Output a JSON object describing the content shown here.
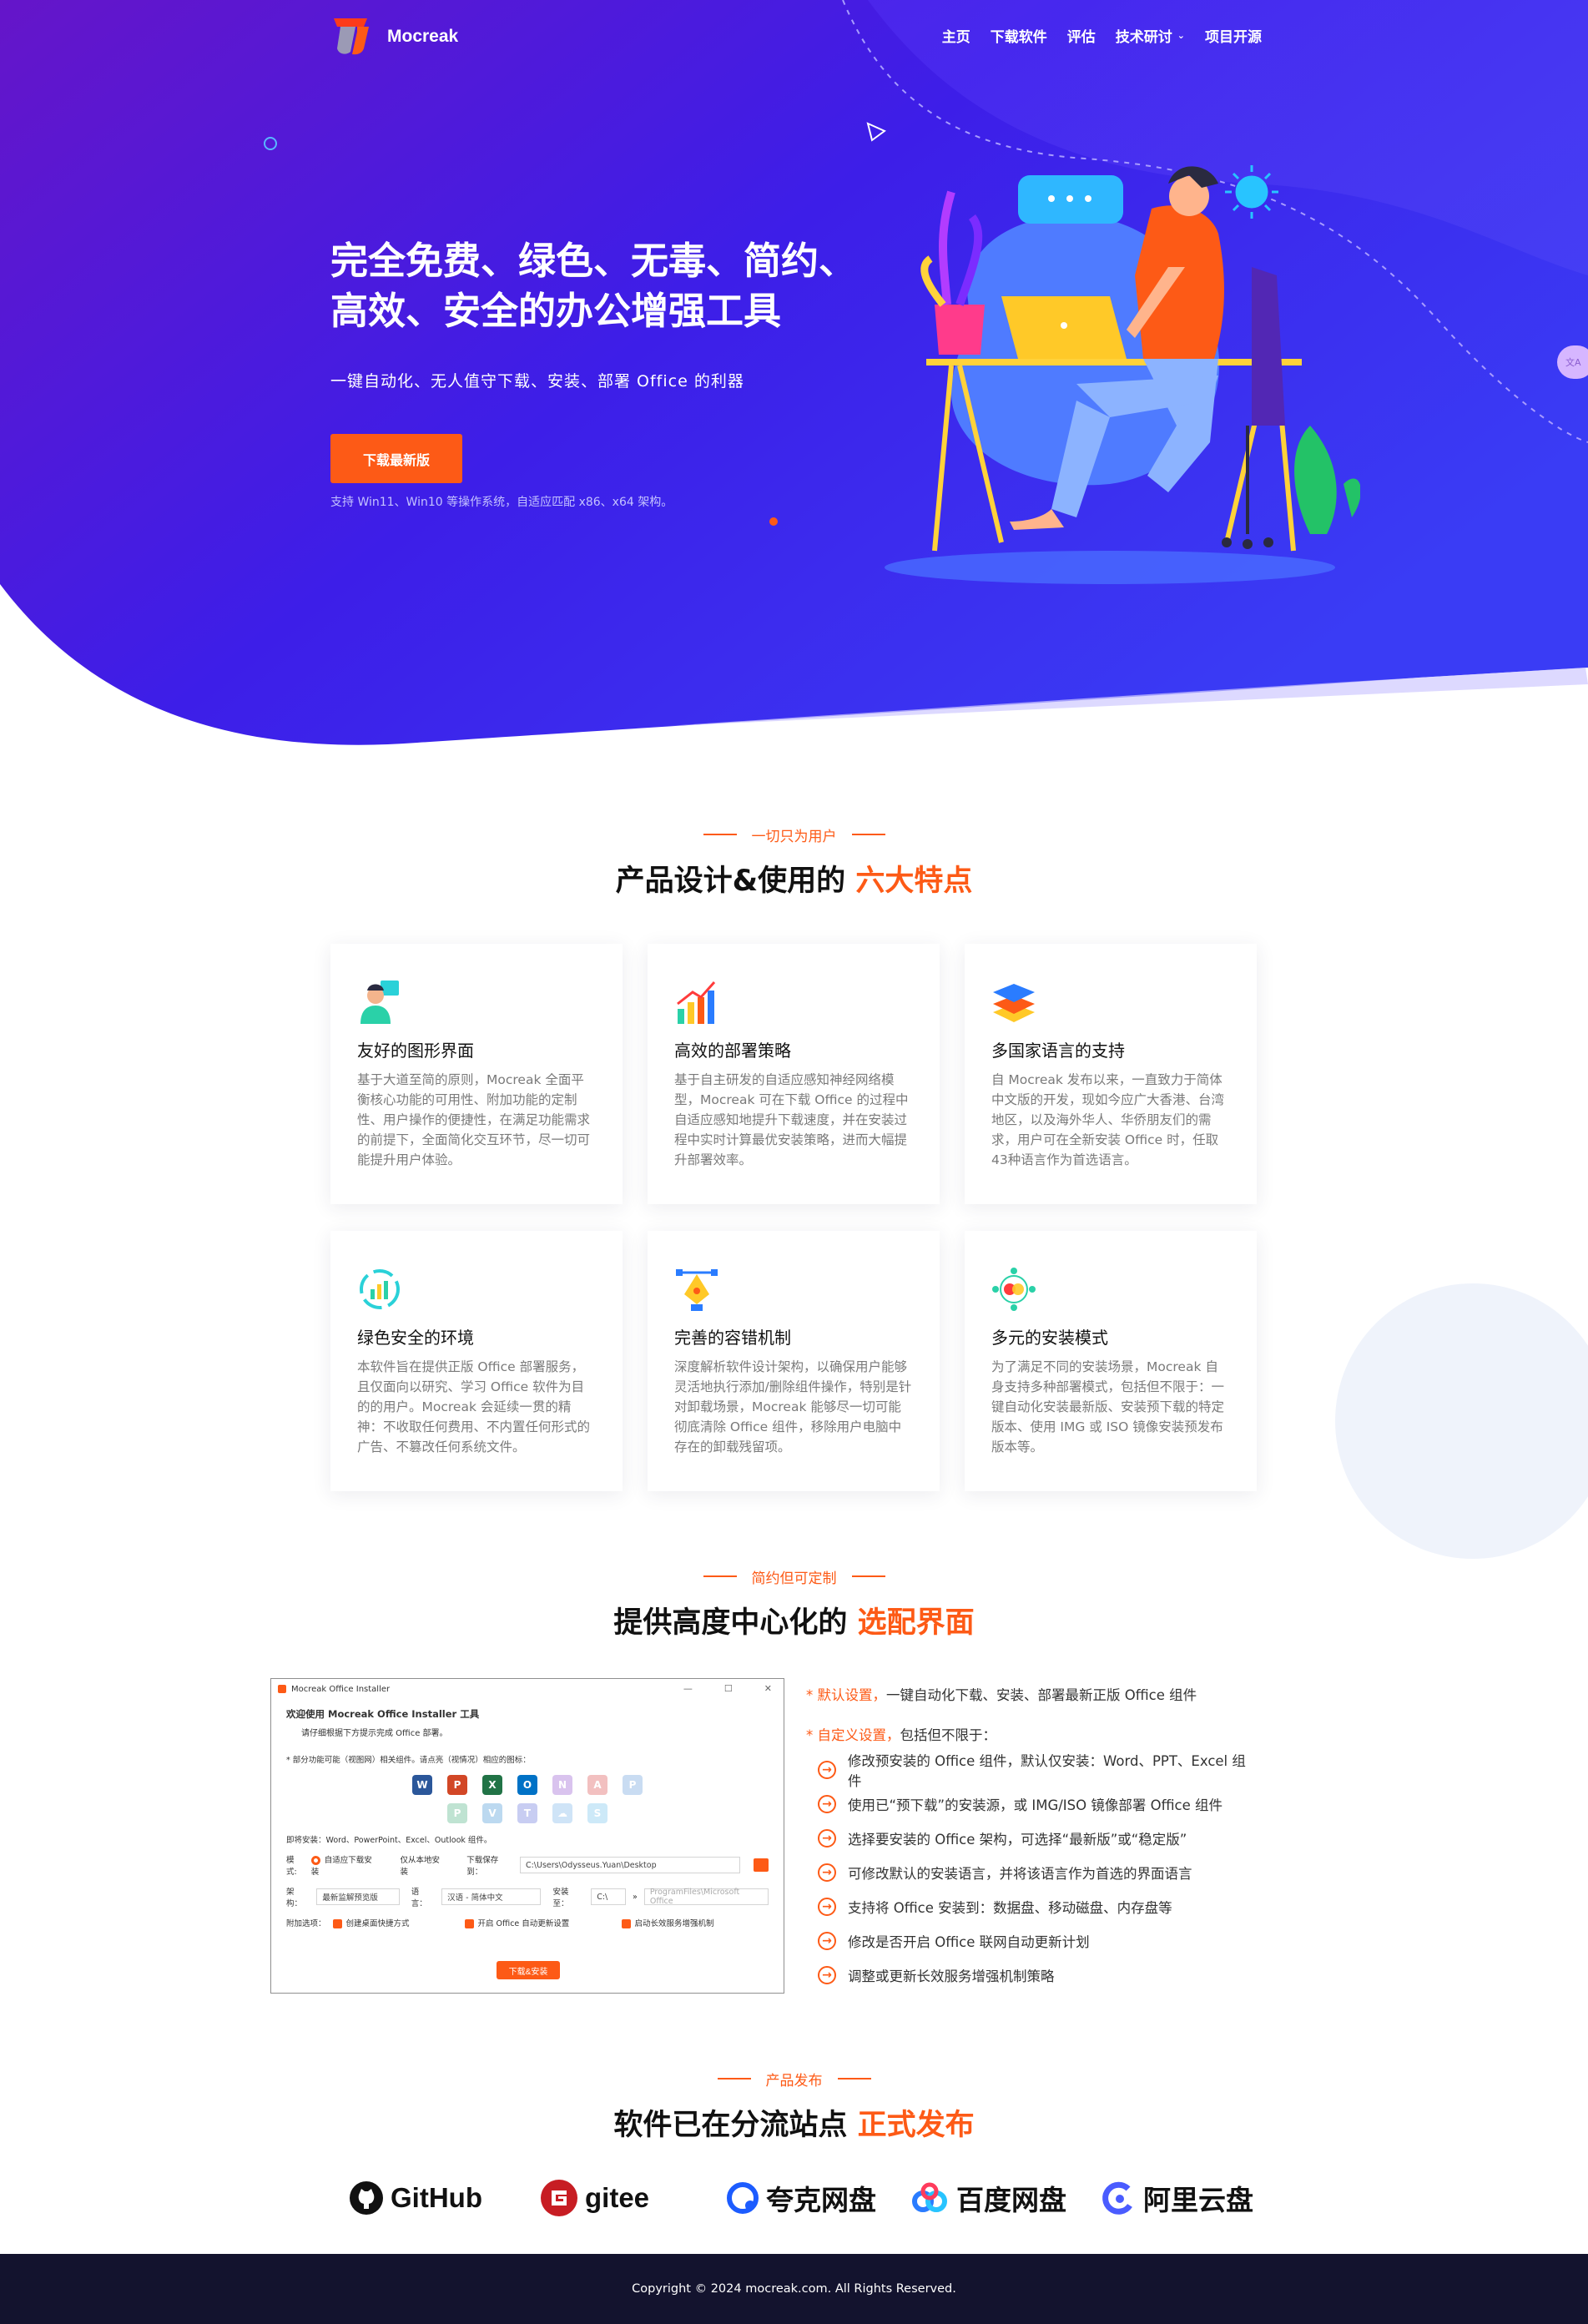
{
  "brand": {
    "name": "Mocreak"
  },
  "nav": {
    "items": [
      "主页",
      "下载软件",
      "评估",
      "技术研讨",
      "项目开源"
    ]
  },
  "hero": {
    "title_line1": "完全免费、绿色、无毒、简约、",
    "title_line2": "高效、安全的办公增强工具",
    "subtitle": "一键自动化、无人值守下载、安装、部署 Office 的利器",
    "button": "下载最新版",
    "note": "支持 Win11、Win10 等操作系统，自适应匹配 x86、x64 架构。"
  },
  "features": {
    "eyebrow": "一切只为用户",
    "title": "产品设计&使用的",
    "title_hl": "六大特点",
    "cards": [
      {
        "icon": "user-interface-icon",
        "title": "友好的图形界面",
        "desc": "基于大道至简的原则，Mocreak 全面平衡核心功能的可用性、附加功能的定制性、用户操作的便捷性，在满足功能需求的前提下，全面简化交互环节，尽一切可能提升用户体验。"
      },
      {
        "icon": "chart-growth-icon",
        "title": "高效的部署策略",
        "desc": "基于自主研发的自适应感知神经网络模型，Mocreak 可在下载 Office 的过程中自适应感知地提升下载速度，并在安装过程中实时计算最优安装策略，进而大幅提升部署效率。"
      },
      {
        "icon": "layers-icon",
        "title": "多国家语言的支持",
        "desc": "自 Mocreak 发布以来，一直致力于简体中文版的开发，现如今应广大香港、台湾地区，以及海外华人、华侨朋友们的需求，用户可在全新安装 Office 时，任取43种语言作为首选语言。"
      },
      {
        "icon": "recycle-chart-icon",
        "title": "绿色安全的环境",
        "desc": "本软件旨在提供正版 Office 部署服务，且仅面向以研究、学习 Office 软件为目的的用户。Mocreak 会延续一贯的精神：不收取任何费用、不内置任何形式的广告、不篡改任何系统文件。"
      },
      {
        "icon": "pen-tool-icon",
        "title": "完善的容错机制",
        "desc": "深度解析软件设计架构，以确保用户能够灵活地执行添加/删除组件操作，特别是针对卸载场景，Mocreak 能够尽一切可能彻底清除 Office 组件，移除用户电脑中存在的卸载残留项。"
      },
      {
        "icon": "network-nodes-icon",
        "title": "多元的安装模式",
        "desc": "为了满足不同的安装场景，Mocreak 自身支持多种部署模式，包括但不限于：一键自动化安装最新版、安装预下载的特定版本、使用 IMG 或 ISO 镜像安装预发布版本等。"
      }
    ]
  },
  "interface": {
    "eyebrow": "简约但可定制",
    "title": "提供高度中心化的",
    "title_hl": "选配界面",
    "window": {
      "title": "Mocreak Office Installer",
      "heading": "欢迎使用 Mocreak Office Installer 工具",
      "sub": "请仔细根据下方提示完成 Office 部署。",
      "note": "* 部分功能可能（视图网）相关组件。请点亮（视情况）相应的图标：",
      "selected": "即将安装：Word、PowerPoint、Excel、Outlook 组件。",
      "mode_label": "模式:",
      "mode_auto": "自适应下载安装",
      "mode_local": "仅从本地安装",
      "save_label": "下载保存到：",
      "save_path": "C:\\Users\\Odysseus.Yuan\\Desktop",
      "arch_label": "架构：",
      "arch_value": "最新监解预览版",
      "lang_label": "语言：",
      "lang_value": "汉语 - 简体中文",
      "install_label": "安装至：",
      "install_drive": "C:\\",
      "install_path": "ProgramFiles\\Microsoft Office",
      "extra_label": "附加选项：",
      "opt1": "创建桌面快捷方式",
      "opt2": "开启 Office 自动更新设置",
      "opt3": "启动长效服务增强机制",
      "button": "下载&安装"
    },
    "default_key": "* 默认设置，",
    "default_text": "一键自动化下载、安装、部署最新正版 Office 组件",
    "custom_key": "* 自定义设置，",
    "custom_text": "包括但不限于：",
    "items": [
      "修改预安装的 Office 组件，默认仅安装：Word、PPT、Excel 组件",
      "使用已“预下载”的安装源，或 IMG/ISO 镜像部署 Office 组件",
      "选择要安装的 Office 架构，可选择“最新版”或“稳定版”",
      "可修改默认的安装语言，并将该语言作为首选的界面语言",
      "支持将 Office 安装到：数据盘、移动磁盘、内存盘等",
      "修改是否开启 Office 联网自动更新计划",
      "调整或更新长效服务增强机制策略"
    ]
  },
  "release": {
    "eyebrow": "产品发布",
    "title": "软件已在分流站点",
    "title_hl": "正式发布",
    "platforms": [
      {
        "name": "GitHub",
        "icon": "github-icon"
      },
      {
        "name": "gitee",
        "icon": "gitee-icon"
      },
      {
        "name": "夸克网盘",
        "icon": "quark-icon"
      },
      {
        "name": "百度网盘",
        "icon": "baidu-pan-icon"
      },
      {
        "name": "阿里云盘",
        "icon": "aliyun-drive-icon"
      }
    ]
  },
  "footer": {
    "copyright": "Copyright © 2024 mocreak.com. All Rights Reserved."
  },
  "colors": {
    "accent": "#fd5a16",
    "hero_start": "#6a1fd4",
    "hero_end": "#3a2bf0",
    "footer": "#13132e"
  }
}
